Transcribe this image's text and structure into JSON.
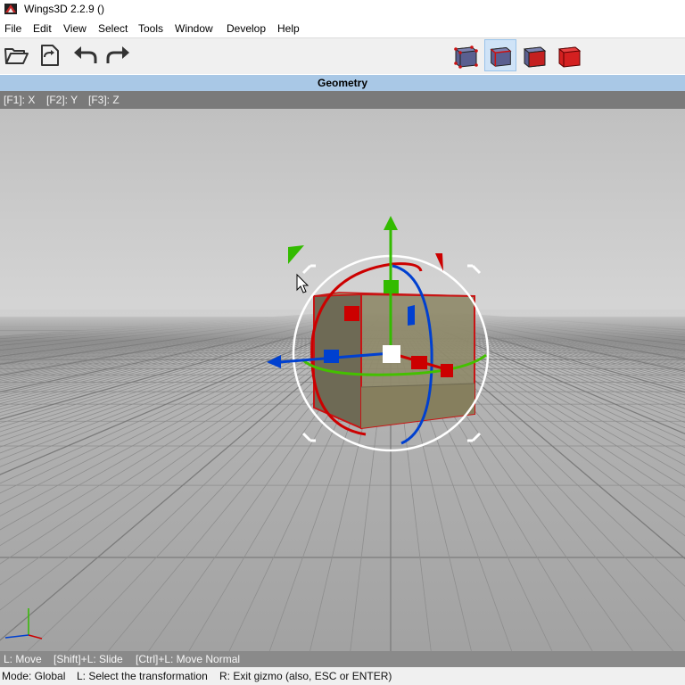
{
  "window": {
    "title": "Wings3D 2.2.9 ()"
  },
  "menu": [
    "File",
    "Edit",
    "View",
    "Select",
    "Tools",
    "Window",
    "Develop",
    "Help"
  ],
  "toolbar": {
    "buttons": [
      "open-icon",
      "save-icon",
      "undo-icon",
      "redo-icon"
    ],
    "selection_modes": [
      "vertex-mode",
      "edge-mode",
      "face-mode",
      "body-mode"
    ],
    "active_mode": "edge-mode"
  },
  "viewport": {
    "header": "Geometry",
    "axis_keys": [
      "[F1]: X",
      "[F2]: Y",
      "[F3]: Z"
    ]
  },
  "hints": [
    "L: Move",
    "[Shift]+L: Slide",
    "[Ctrl]+L: Move Normal"
  ],
  "status": {
    "mode": "Mode: Global",
    "select": "L: Select the transformation",
    "exit": "R: Exit gizmo (also, ESC or ENTER)"
  },
  "colors": {
    "x_axis": "#cc0000",
    "y_axis": "#33bb00",
    "z_axis": "#0040d0",
    "header_bg": "#a9c8e6",
    "floor": "#a6a6a6"
  }
}
